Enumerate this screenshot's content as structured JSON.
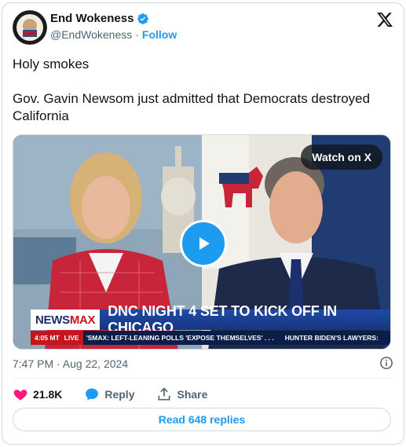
{
  "author": {
    "name": "End Wokeness",
    "handle": "@EndWokeness",
    "separator": "·",
    "follow_label": "Follow",
    "verified_color": "#1d9bf0"
  },
  "tweet": {
    "lines": [
      "Holy smokes",
      "Gov. Gavin Newsom just admitted that Democrats destroyed California"
    ],
    "timestamp": "7:47 PM · Aug 22, 2024"
  },
  "video": {
    "watch_label": "Watch on X",
    "network_logo_a": "NEWS",
    "network_logo_b": "MAX",
    "headline": "DNC NIGHT 4 SET TO KICK OFF IN CHICAGO",
    "ticker_time": "4:05 MT",
    "ticker_live": "LIVE",
    "ticker_text": "'SMAX: LEFT-LEANING POLLS 'EXPOSE THEMSELVES' . . .",
    "ticker_text_2": "HUNTER BIDEN'S LAWYERS:"
  },
  "actions": {
    "likes": "21.8K",
    "reply_label": "Reply",
    "share_label": "Share"
  },
  "read_replies_label": "Read 648 replies",
  "colors": {
    "accent": "#1d9bf0",
    "like": "#f91880",
    "muted": "#536471",
    "border": "#cfd9de"
  },
  "icons": [
    "verified-badge-icon",
    "x-logo-icon",
    "play-icon",
    "info-icon",
    "heart-icon",
    "reply-bubble-icon",
    "share-icon"
  ]
}
